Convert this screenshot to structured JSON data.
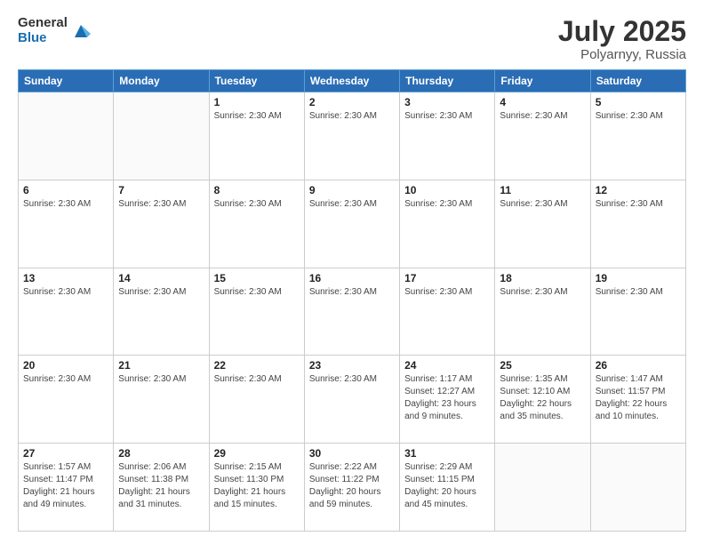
{
  "logo": {
    "general": "General",
    "blue": "Blue"
  },
  "title": "July 2025",
  "subtitle": "Polyarnyy, Russia",
  "weekdays": [
    "Sunday",
    "Monday",
    "Tuesday",
    "Wednesday",
    "Thursday",
    "Friday",
    "Saturday"
  ],
  "weeks": [
    [
      {
        "day": "",
        "info": []
      },
      {
        "day": "",
        "info": []
      },
      {
        "day": "1",
        "info": [
          "Sunrise: 2:30 AM"
        ]
      },
      {
        "day": "2",
        "info": [
          "Sunrise: 2:30 AM"
        ]
      },
      {
        "day": "3",
        "info": [
          "Sunrise: 2:30 AM"
        ]
      },
      {
        "day": "4",
        "info": [
          "Sunrise: 2:30 AM"
        ]
      },
      {
        "day": "5",
        "info": [
          "Sunrise: 2:30 AM"
        ]
      }
    ],
    [
      {
        "day": "6",
        "info": [
          "Sunrise: 2:30 AM"
        ]
      },
      {
        "day": "7",
        "info": [
          "Sunrise: 2:30 AM"
        ]
      },
      {
        "day": "8",
        "info": [
          "Sunrise: 2:30 AM"
        ]
      },
      {
        "day": "9",
        "info": [
          "Sunrise: 2:30 AM"
        ]
      },
      {
        "day": "10",
        "info": [
          "Sunrise: 2:30 AM"
        ]
      },
      {
        "day": "11",
        "info": [
          "Sunrise: 2:30 AM"
        ]
      },
      {
        "day": "12",
        "info": [
          "Sunrise: 2:30 AM"
        ]
      }
    ],
    [
      {
        "day": "13",
        "info": [
          "Sunrise: 2:30 AM"
        ]
      },
      {
        "day": "14",
        "info": [
          "Sunrise: 2:30 AM"
        ]
      },
      {
        "day": "15",
        "info": [
          "Sunrise: 2:30 AM"
        ]
      },
      {
        "day": "16",
        "info": [
          "Sunrise: 2:30 AM"
        ]
      },
      {
        "day": "17",
        "info": [
          "Sunrise: 2:30 AM"
        ]
      },
      {
        "day": "18",
        "info": [
          "Sunrise: 2:30 AM"
        ]
      },
      {
        "day": "19",
        "info": [
          "Sunrise: 2:30 AM"
        ]
      }
    ],
    [
      {
        "day": "20",
        "info": [
          "Sunrise: 2:30 AM"
        ]
      },
      {
        "day": "21",
        "info": [
          "Sunrise: 2:30 AM"
        ]
      },
      {
        "day": "22",
        "info": [
          "Sunrise: 2:30 AM"
        ]
      },
      {
        "day": "23",
        "info": [
          "Sunrise: 2:30 AM"
        ]
      },
      {
        "day": "24",
        "info": [
          "Sunrise: 1:17 AM",
          "Sunset: 12:27 AM",
          "Daylight: 23 hours and 9 minutes."
        ]
      },
      {
        "day": "25",
        "info": [
          "Sunrise: 1:35 AM",
          "Sunset: 12:10 AM",
          "Daylight: 22 hours and 35 minutes."
        ]
      },
      {
        "day": "26",
        "info": [
          "Sunrise: 1:47 AM",
          "Sunset: 11:57 PM",
          "Daylight: 22 hours and 10 minutes."
        ]
      }
    ],
    [
      {
        "day": "27",
        "info": [
          "Sunrise: 1:57 AM",
          "Sunset: 11:47 PM",
          "Daylight: 21 hours and 49 minutes."
        ]
      },
      {
        "day": "28",
        "info": [
          "Sunrise: 2:06 AM",
          "Sunset: 11:38 PM",
          "Daylight: 21 hours and 31 minutes."
        ]
      },
      {
        "day": "29",
        "info": [
          "Sunrise: 2:15 AM",
          "Sunset: 11:30 PM",
          "Daylight: 21 hours and 15 minutes."
        ]
      },
      {
        "day": "30",
        "info": [
          "Sunrise: 2:22 AM",
          "Sunset: 11:22 PM",
          "Daylight: 20 hours and 59 minutes."
        ]
      },
      {
        "day": "31",
        "info": [
          "Sunrise: 2:29 AM",
          "Sunset: 11:15 PM",
          "Daylight: 20 hours and 45 minutes."
        ]
      },
      {
        "day": "",
        "info": []
      },
      {
        "day": "",
        "info": []
      }
    ]
  ]
}
